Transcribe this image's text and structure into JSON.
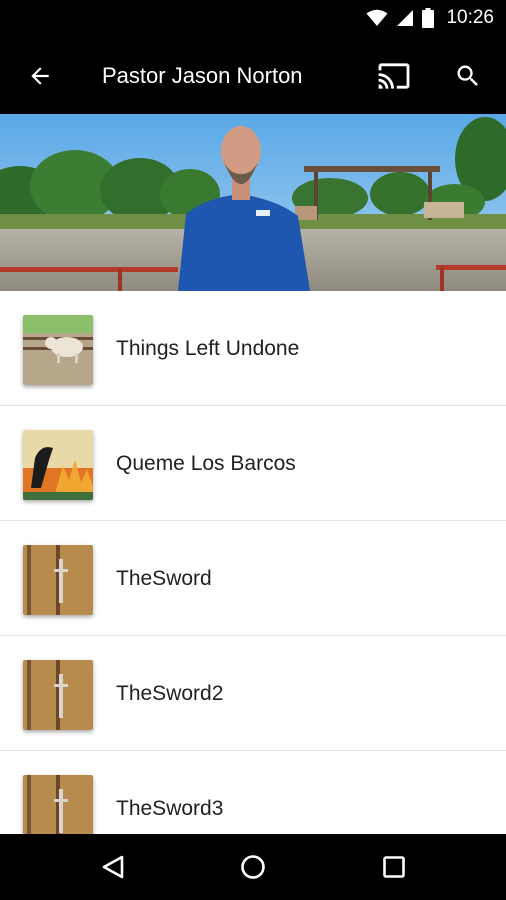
{
  "status_bar": {
    "time": "10:26",
    "icons": [
      "wifi-icon",
      "cellular-signal-icon",
      "battery-icon"
    ]
  },
  "toolbar": {
    "title": "Pastor Jason Norton",
    "back_icon": "arrow-left-icon",
    "cast_icon": "cast-icon",
    "search_icon": "search-icon"
  },
  "header_image": {
    "description_icon": "hero-photo"
  },
  "items": [
    {
      "title": "Things Left Undone",
      "thumb": "cow-thumbnail"
    },
    {
      "title": "Queme Los Barcos",
      "thumb": "horse-fire-thumbnail"
    },
    {
      "title": "TheSword",
      "thumb": "bible-thumbnail"
    },
    {
      "title": "TheSword2",
      "thumb": "bible-thumbnail"
    },
    {
      "title": "TheSword3",
      "thumb": "bible-thumbnail"
    }
  ],
  "nav_bar": {
    "icons": [
      "back-triangle-icon",
      "home-circle-icon",
      "recents-square-icon"
    ]
  },
  "colors": {
    "bar_background": "#000000",
    "text_primary": "#212121",
    "divider": "#e4e4e4"
  }
}
